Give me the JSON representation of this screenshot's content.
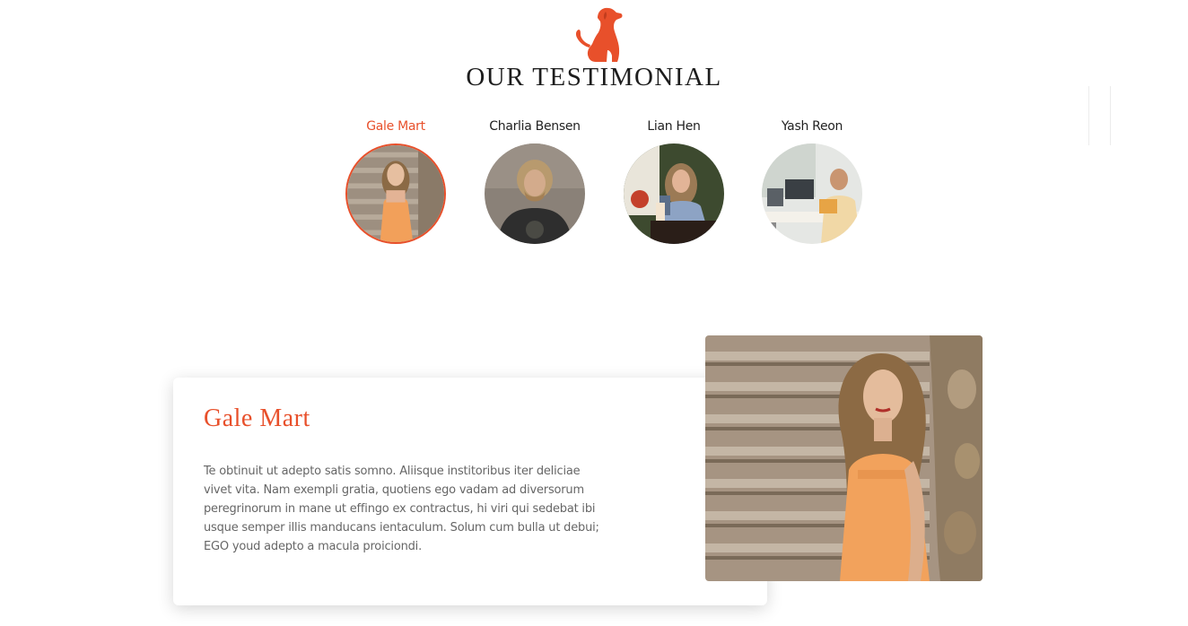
{
  "section": {
    "title": "OUR TESTIMONIAL",
    "logo_icon": "dog-icon",
    "accent_color": "#e8502b"
  },
  "tabs": [
    {
      "name": "Gale Mart",
      "active": true,
      "avatar": "woman-on-stairs-photo"
    },
    {
      "name": "Charlia Bensen",
      "active": false,
      "avatar": "man-long-hair-photo"
    },
    {
      "name": "Lian Hen",
      "active": false,
      "avatar": "woman-with-phone-cafe-photo"
    },
    {
      "name": "Yash Reon",
      "active": false,
      "avatar": "man-at-office-desk-photo"
    }
  ],
  "testimonial": {
    "name": "Gale Mart",
    "text": "Te obtinuit ut adepto satis somno. Aliisque institoribus iter deliciae vivet vita. Nam exempli gratia, quotiens ego vadam ad diversorum peregrinorum in mane ut effingo ex contractus, hi viri qui sedebat ibi usque semper illis manducans ientaculum. Solum cum bulla ut debui; EGO youd adepto a macula proiciondi.",
    "photo": "woman-on-stairs-photo"
  }
}
